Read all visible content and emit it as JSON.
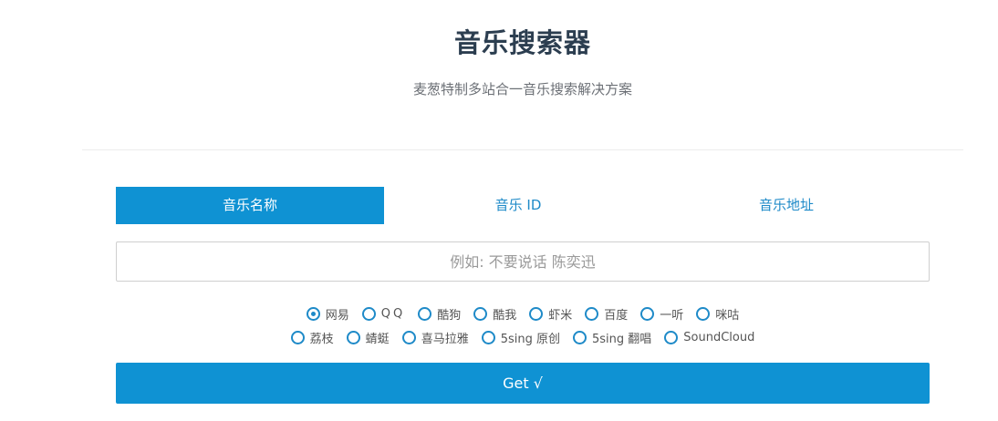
{
  "header": {
    "title": "音乐搜索器",
    "subtitle": "麦葱特制多站合一音乐搜索解决方案"
  },
  "tabs": [
    {
      "label": "音乐名称",
      "active": true
    },
    {
      "label": "音乐 ID",
      "active": false
    },
    {
      "label": "音乐地址",
      "active": false
    }
  ],
  "search": {
    "placeholder": "例如: 不要说话 陈奕迅",
    "value": ""
  },
  "sources": {
    "selected": "网易",
    "row1": [
      "网易",
      "QQ",
      "酷狗",
      "酷我",
      "虾米",
      "百度",
      "一听",
      "咪咕"
    ],
    "row2": [
      "荔枝",
      "蜻蜓",
      "喜马拉雅",
      "5sing 原创",
      "5sing 翻唱",
      "SoundCloud"
    ]
  },
  "submit": {
    "label": "Get √"
  },
  "colors": {
    "accent": "#0f92d3",
    "title": "#2c3e50"
  }
}
